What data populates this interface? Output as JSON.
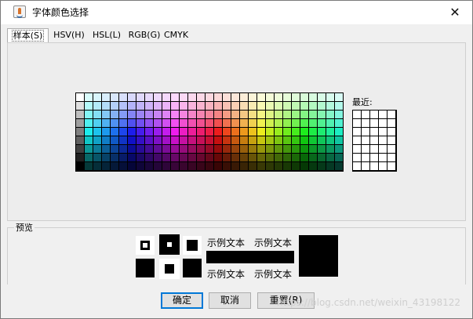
{
  "window": {
    "title": "字体颜色选择"
  },
  "tabs": [
    {
      "label": "样本(S)",
      "active": true
    },
    {
      "label": "HSV(H)",
      "active": false
    },
    {
      "label": "HSL(L)",
      "active": false
    },
    {
      "label": "RGB(G)",
      "active": false
    },
    {
      "label": "CMYK",
      "active": false
    }
  ],
  "recent": {
    "label": "最近:"
  },
  "preview": {
    "label": "预览",
    "sample_text": "示例文本"
  },
  "buttons": {
    "ok": "确定",
    "cancel": "取消",
    "reset": "重置(R)"
  },
  "watermark": "https://blog.csdn.net/weixin_43198122",
  "colors": {
    "window_bg": "#f0f0f0",
    "selected_color": "#000000",
    "default_button_border": "#0078d7"
  },
  "icons": {
    "app": "java-coffee-cup-icon",
    "close": "close-x-icon"
  }
}
